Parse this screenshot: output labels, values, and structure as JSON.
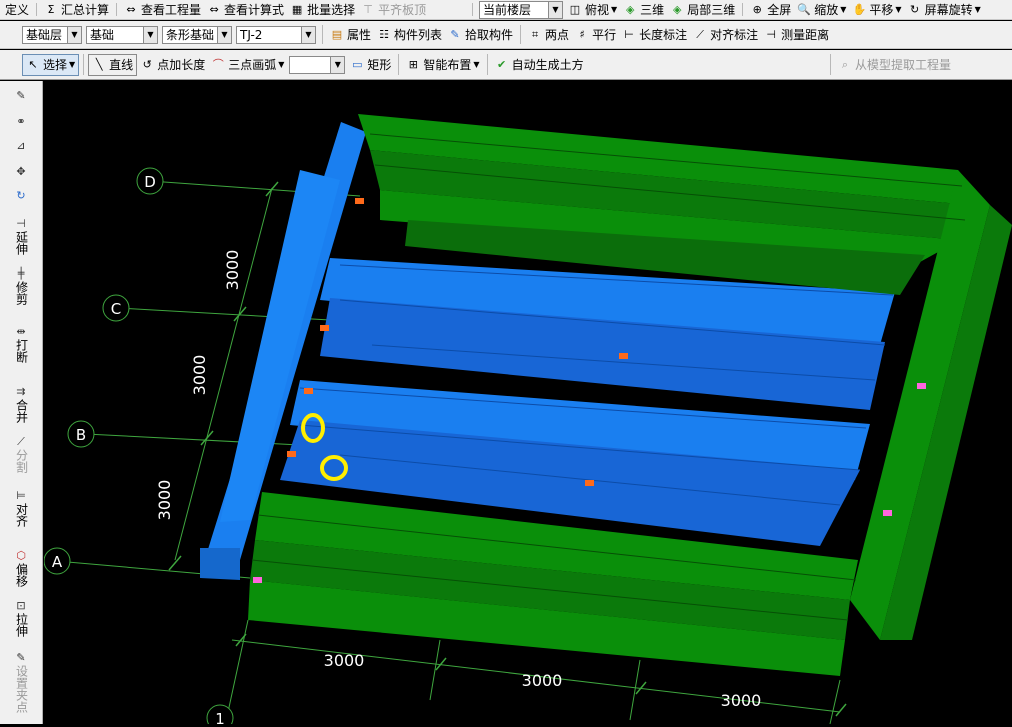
{
  "toolbar_top": {
    "items": [
      "定义",
      "汇总计算",
      "查看工程量",
      "查看计算式",
      "批量选择",
      "平齐板顶"
    ],
    "floor_combo": "当前楼层",
    "view_items": [
      "俯视",
      "三维",
      "局部三维",
      "全屏",
      "缩放",
      "平移",
      "屏幕旋转"
    ]
  },
  "toolbar_mid": {
    "layer_combo": "基础层",
    "category_combo": "基础",
    "type_combo": "条形基础",
    "element_combo": "TJ-2",
    "items": [
      "属性",
      "构件列表",
      "拾取构件",
      "两点",
      "平行",
      "长度标注",
      "对齐标注",
      "测量距离"
    ]
  },
  "toolbar_draw": {
    "select": "选择",
    "items": [
      "直线",
      "点加长度",
      "三点画弧"
    ],
    "rect": "矩形",
    "smart_layout": "智能布置",
    "auto_earth": "自动生成土方",
    "extract": "从模型提取工程量"
  },
  "sidebar": {
    "items": [
      "延伸",
      "修剪",
      "打断",
      "合并",
      "分割",
      "对齐",
      "偏移",
      "拉伸",
      "设置夹点"
    ]
  },
  "viewport": {
    "axis_labels": [
      "D",
      "C",
      "B",
      "A",
      "1"
    ],
    "vertical_dims": [
      "3000",
      "3000",
      "3000"
    ],
    "horizontal_dims": [
      "3000",
      "3000",
      "3000"
    ],
    "colors": {
      "background": "#000000",
      "blue_beams": "#1a7ff0",
      "green_beams": "#0a8f0a",
      "grid": "#3fa63f",
      "marker": "#ffee00"
    }
  }
}
